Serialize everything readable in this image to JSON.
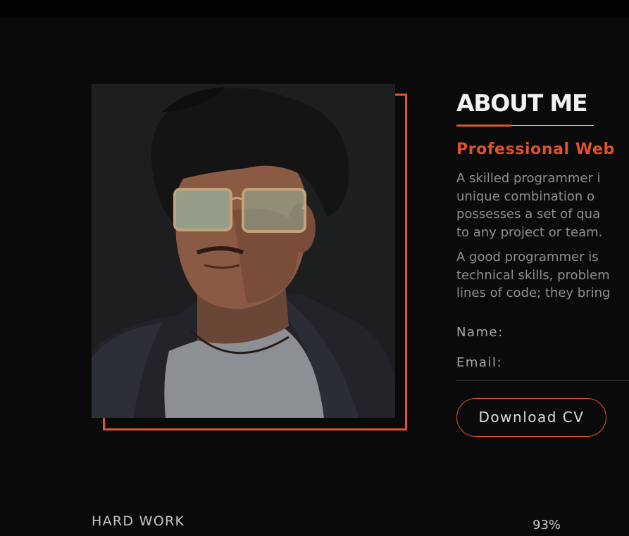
{
  "about": {
    "heading": "ABOUT ME",
    "subtitle": "Professional Web",
    "paragraph1": [
      "A skilled programmer i",
      "unique combination o",
      "possesses a set of qua",
      "to any project or team."
    ],
    "paragraph2": [
      "A good programmer is",
      "technical skills, problem",
      "lines of code; they bring"
    ],
    "name_label": "Name:",
    "email_label": "Email:",
    "cv_button": "Download CV"
  },
  "skills": [
    {
      "label": "HARD WORK",
      "percent_text": "93%",
      "percent": 93
    }
  ],
  "colors": {
    "accent": "#e0522a",
    "background": "#0b0a0b",
    "heading": "#f2f2f2",
    "body_text": "#8e8e93"
  }
}
